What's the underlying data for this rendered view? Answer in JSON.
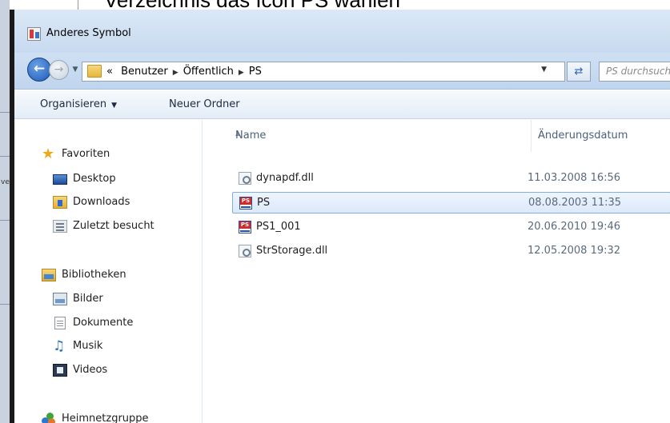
{
  "background": {
    "heading": "Verzeichnis das Icon PS wählen",
    "side_text": "ve"
  },
  "window": {
    "title": "Anderes Symbol"
  },
  "address": {
    "prefix": "«",
    "crumbs": [
      "Benutzer",
      "Öffentlich",
      "PS"
    ],
    "search_placeholder": "PS durchsuchen"
  },
  "toolbar": {
    "organize": "Organisieren",
    "new_folder": "Neuer Ordner"
  },
  "nav": {
    "favorites": "Favoriten",
    "desktop": "Desktop",
    "downloads": "Downloads",
    "recent": "Zuletzt besucht",
    "libraries": "Bibliotheken",
    "pictures": "Bilder",
    "documents": "Dokumente",
    "music": "Musik",
    "videos": "Videos",
    "homegroup": "Heimnetzgruppe"
  },
  "columns": {
    "name": "Name",
    "date": "Änderungsdatum"
  },
  "files": [
    {
      "name": "dynapdf.dll",
      "date": "11.03.2008 16:56",
      "icon": "dll-file-icon"
    },
    {
      "name": "PS",
      "date": "08.08.2003 11:35",
      "icon": "ps-icon-file-icon",
      "selected": true
    },
    {
      "name": "PS1_001",
      "date": "20.06.2010 19:46",
      "icon": "ps-icon-file-icon"
    },
    {
      "name": "StrStorage.dll",
      "date": "12.05.2008 19:32",
      "icon": "dll-file-icon"
    }
  ],
  "colors": {
    "selection": "#dbe9fa",
    "selection_border": "#84acdd",
    "toolbar": "#e3ecf7"
  }
}
